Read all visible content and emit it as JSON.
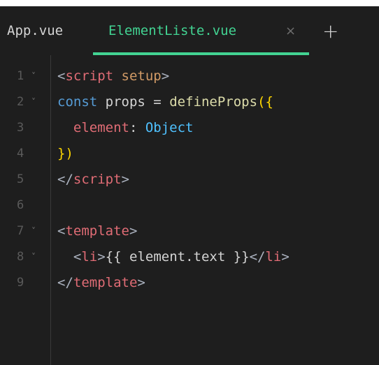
{
  "tabs": [
    {
      "label": "App.vue",
      "active": false
    },
    {
      "label": "ElementListe.vue",
      "active": true
    }
  ],
  "tab_close_icon": "×",
  "tab_add_icon": "+",
  "colors": {
    "accent": "#42d392",
    "background": "#1e1e1e",
    "line_number": "#5a5a5a"
  },
  "lines": [
    {
      "num": "1",
      "fold": true,
      "tokens": [
        {
          "t": "<",
          "c": "punct"
        },
        {
          "t": "script",
          "c": "tag"
        },
        {
          "t": " ",
          "c": "ident"
        },
        {
          "t": "setup",
          "c": "attr"
        },
        {
          "t": ">",
          "c": "punct"
        }
      ]
    },
    {
      "num": "2",
      "fold": true,
      "tokens": [
        {
          "t": "const",
          "c": "kw"
        },
        {
          "t": " props ",
          "c": "ident"
        },
        {
          "t": "=",
          "c": "op"
        },
        {
          "t": " ",
          "c": "ident"
        },
        {
          "t": "defineProps",
          "c": "func"
        },
        {
          "t": "({",
          "c": "bracket"
        }
      ]
    },
    {
      "num": "3",
      "fold": false,
      "tokens": [
        {
          "t": "  ",
          "c": "ident"
        },
        {
          "t": "element",
          "c": "prop"
        },
        {
          "t": ": ",
          "c": "ident"
        },
        {
          "t": "Object",
          "c": "type"
        }
      ]
    },
    {
      "num": "4",
      "fold": false,
      "tokens": [
        {
          "t": "})",
          "c": "bracket"
        }
      ]
    },
    {
      "num": "5",
      "fold": false,
      "tokens": [
        {
          "t": "</",
          "c": "punct"
        },
        {
          "t": "script",
          "c": "tag"
        },
        {
          "t": ">",
          "c": "punct"
        }
      ]
    },
    {
      "num": "6",
      "fold": false,
      "tokens": []
    },
    {
      "num": "7",
      "fold": true,
      "tokens": [
        {
          "t": "<",
          "c": "punct"
        },
        {
          "t": "template",
          "c": "tag"
        },
        {
          "t": ">",
          "c": "punct"
        }
      ]
    },
    {
      "num": "8",
      "fold": true,
      "tokens": [
        {
          "t": "  ",
          "c": "ident"
        },
        {
          "t": "<",
          "c": "punct"
        },
        {
          "t": "li",
          "c": "tag"
        },
        {
          "t": ">",
          "c": "punct"
        },
        {
          "t": "{{ element.text }}",
          "c": "interp"
        },
        {
          "t": "</",
          "c": "punct"
        },
        {
          "t": "li",
          "c": "tag"
        },
        {
          "t": ">",
          "c": "punct"
        }
      ]
    },
    {
      "num": "9",
      "fold": false,
      "tokens": [
        {
          "t": "</",
          "c": "punct"
        },
        {
          "t": "template",
          "c": "tag"
        },
        {
          "t": ">",
          "c": "punct"
        }
      ]
    }
  ]
}
